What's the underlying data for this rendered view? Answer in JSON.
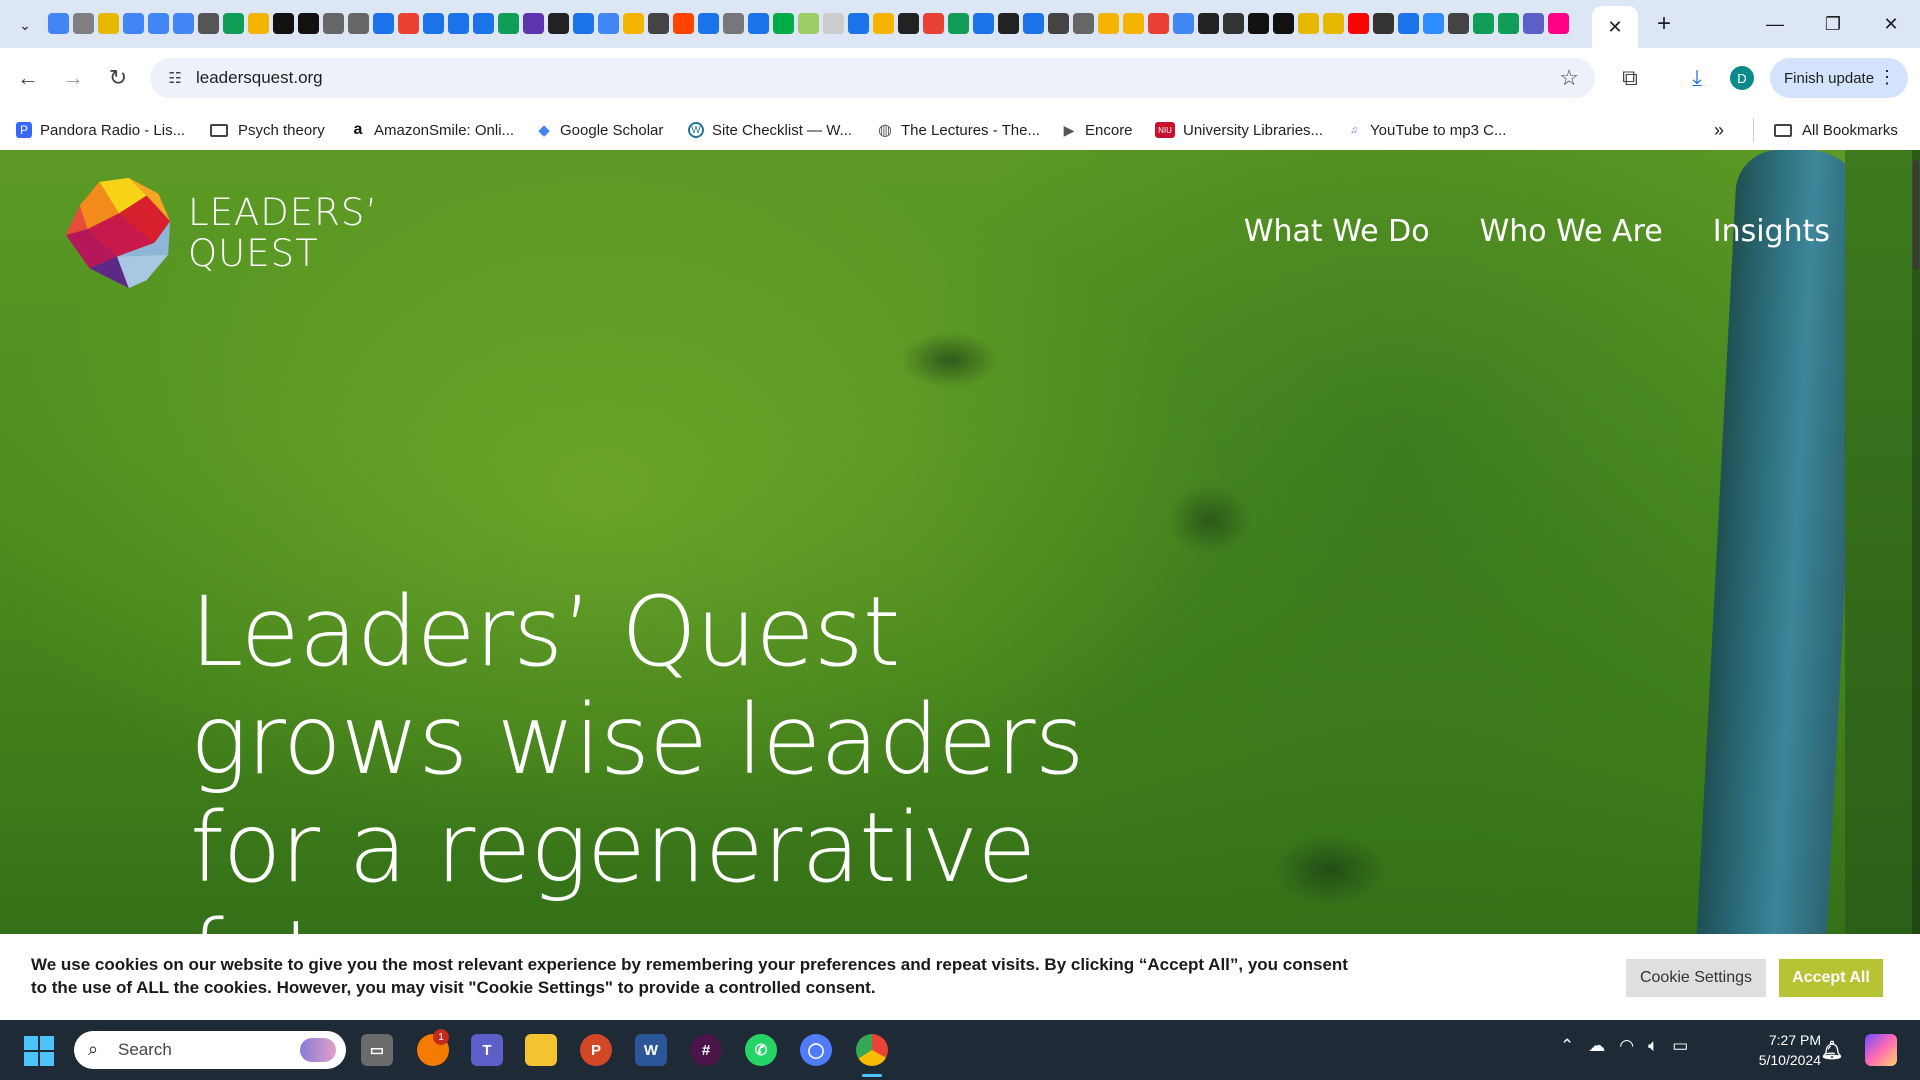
{
  "browser": {
    "active_tab_close": "✕",
    "new_tab": "+",
    "url": "leadersquest.org",
    "finish_update_label": "Finish update",
    "profile_initial": "D",
    "tab_favicon_colors": [
      "#4285f4",
      "#7f7f7f",
      "#e6b800",
      "#4285f4",
      "#4285f4",
      "#4285f4",
      "#555",
      "#0f9d58",
      "#f4b400",
      "#111",
      "#111",
      "#666",
      "#666",
      "#1a73e8",
      "#e94235",
      "#1a73e8",
      "#1a73e8",
      "#1a73e8",
      "#0f9d58",
      "#5e35b1",
      "#222",
      "#1a73e8",
      "#4285f4",
      "#f4b400",
      "#444",
      "#ff4500",
      "#1a73e8",
      "#777",
      "#1a73e8",
      "#00ac47",
      "#9ccc65",
      "#ccc",
      "#1a73e8",
      "#f4b400",
      "#222",
      "#e94235",
      "#0f9d58",
      "#1a73e8",
      "#222",
      "#1a73e8",
      "#444",
      "#666",
      "#f4b400",
      "#f4b400",
      "#e94235",
      "#4285f4",
      "#222",
      "#333",
      "#111",
      "#111",
      "#e6b800",
      "#e6b800",
      "#ff0000",
      "#333",
      "#1a73e8",
      "#2d8cff",
      "#444",
      "#0f9d58",
      "#0f9d58",
      "#5b5fc7",
      "#ff0084"
    ]
  },
  "bookmarks": [
    {
      "label": "Pandora Radio - Lis...",
      "icon": "pandora-icon",
      "color": "#3668ff"
    },
    {
      "label": "Psych theory",
      "icon": "folder-icon"
    },
    {
      "label": "AmazonSmile: Onli...",
      "icon": "amazon-icon",
      "color": "#111111"
    },
    {
      "label": "Google Scholar",
      "icon": "scholar-icon",
      "color": "#4285f4"
    },
    {
      "label": "Site Checklist — W...",
      "icon": "wordpress-icon",
      "color": "#21759b"
    },
    {
      "label": "The Lectures - The...",
      "icon": "globe-icon",
      "color": "#555555"
    },
    {
      "label": "Encore",
      "icon": "play-icon",
      "color": "#555555"
    },
    {
      "label": "University Libraries...",
      "icon": "niu-icon",
      "color": "#c8102e"
    },
    {
      "label": "YouTube to mp3 C...",
      "icon": "mp3-icon",
      "color": "#6b6bd6"
    }
  ],
  "bookmarks_overflow": "»",
  "all_bookmarks_label": "All Bookmarks",
  "site": {
    "logo_line1": "LEADERS’",
    "logo_line2": "QUEST",
    "nav": [
      "What We Do",
      "Who We Are",
      "Insights"
    ],
    "headline": "Leaders’ Quest grows wise leaders for a regenerative future."
  },
  "cookie_banner": {
    "text": "We use cookies on our website to give you the most relevant experience by remembering your preferences and repeat visits. By clicking “Accept All”, you consent to the use of ALL the cookies. However, you may visit \"Cookie Settings\" to provide a controlled consent.",
    "settings_label": "Cookie Settings",
    "accept_label": "Accept All",
    "accent_color": "#b5c334"
  },
  "taskbar": {
    "search_placeholder": "Search",
    "notification_count": "1",
    "time": "7:27 PM",
    "date": "5/10/2024"
  }
}
